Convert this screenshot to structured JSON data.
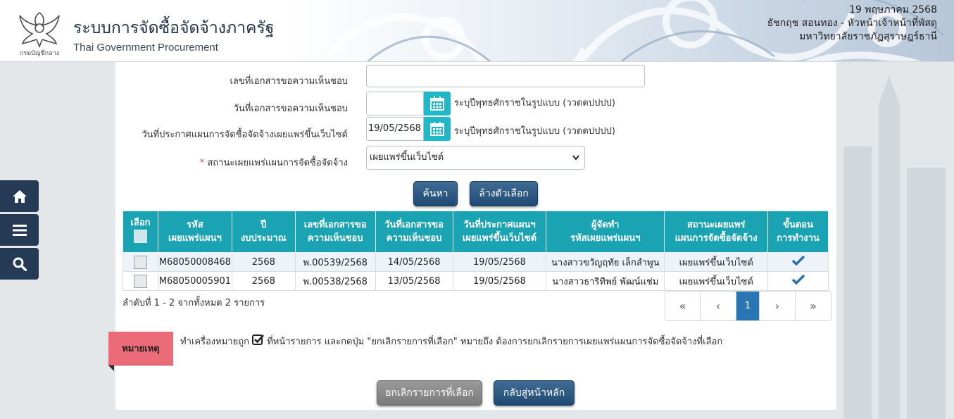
{
  "header": {
    "title_th": "ระบบการจัดซื้อจัดจ้างภาครัฐ",
    "title_en": "Thai Government Procurement",
    "logo_text": "กรมบัญชีกลาง",
    "date": "19 พฤษภาคม 2568",
    "user": "ธัชกฤช สอนทอง - หัวหน้าเจ้าหน้าที่พัสดุ",
    "org": "มหาวิทยาลัยราชภัฏสุราษฎร์ธานี"
  },
  "sidebar": {
    "items": [
      {
        "icon": "home-icon"
      },
      {
        "icon": "menu-icon"
      },
      {
        "icon": "search-icon"
      }
    ]
  },
  "form": {
    "doc_no_label": "เลขที่เอกสารขอความเห็นชอบ",
    "doc_no_value": "",
    "doc_date_label": "วันที่เอกสารขอความเห็นชอบ",
    "doc_date_value": "",
    "doc_date_hint": "ระบุปีพุทธศักราชในรูปแบบ (ววดดปปปป)",
    "publish_date_label": "วันที่ประกาศแผนการจัดซื้อจัดจ้างเผยแพร่ขึ้นเว็บไซต์",
    "publish_date_value": "19/05/2568",
    "publish_date_hint": "ระบุปีพุทธศักราชในรูปแบบ (ววดดปปปป)",
    "status_required_mark": "*",
    "status_label": "สถานะเผยแพร่แผนการจัดซื้อจัดจ้าง",
    "status_value": "เผยแพร่ขึ้นเว็บไซต์",
    "search_button": "ค้นหา",
    "clear_button": "ล้างตัวเลือก"
  },
  "table": {
    "headers": [
      [
        "เลือก"
      ],
      [
        "รหัส",
        "เผยแพร่แผนฯ"
      ],
      [
        "ปี",
        "งบประมาณ"
      ],
      [
        "เลขที่เอกสารขอ",
        "ความเห็นชอบ"
      ],
      [
        "วันที่เอกสารขอ",
        "ความเห็นชอบ"
      ],
      [
        "วันที่ประกาศแผนฯ",
        "เผยแพร่ขึ้นเว็บไซต์"
      ],
      [
        "ผู้จัดทำ",
        "รหัสเผยแพร่แผนฯ"
      ],
      [
        "สถานะเผยแพร่",
        "แผนการจัดซื้อจัดจ้าง"
      ],
      [
        "ขั้นตอน",
        "การทำงาน"
      ]
    ],
    "rows": [
      {
        "code": "M68050008468",
        "year": "2568",
        "doc_no": "พ.00539/2568",
        "doc_date": "14/05/2568",
        "publish_date": "19/05/2568",
        "creator": "นางสาวขวัญฤทัย เล็กลำพูน",
        "status": "เผยแพร่ขึ้นเว็บไซต์"
      },
      {
        "code": "M68050005901",
        "year": "2568",
        "doc_no": "พ.00538/2568",
        "doc_date": "13/05/2568",
        "publish_date": "19/05/2568",
        "creator": "นางสาวธาริทิพย์ พัฒน์แช่ม",
        "status": "เผยแพร่ขึ้นเว็บไซต์"
      }
    ],
    "count_text": "ลำดับที่ 1 - 2 จากทั้งหมด 2 รายการ"
  },
  "pager": {
    "first": "«",
    "prev": "‹",
    "current": "1",
    "next": "›",
    "last": "»"
  },
  "note": {
    "tag": "หมายเหตุ",
    "text_before": "ทำเครื่องหมายถูก",
    "text_after": "ที่หน้ารายการ และกดปุ่ม \"ยกเลิกรายการที่เลือก\" หมายถึง ต้องการยกเลิกรายการเผยแพร่แผนการจัดซื้อจัดจ้างที่เลือก"
  },
  "footer_buttons": {
    "cancel_selected": "ยกเลิกรายการที่เลือก",
    "back_home": "กลับสู่หน้าหลัก"
  },
  "colors": {
    "header_table": "#1aa3b3",
    "calendar_button": "#1fb8c8",
    "primary_button": "#1f4a74",
    "sidebar": "#243a55",
    "note_tag": "#ec6b78",
    "pager_active": "#2a76b5"
  }
}
